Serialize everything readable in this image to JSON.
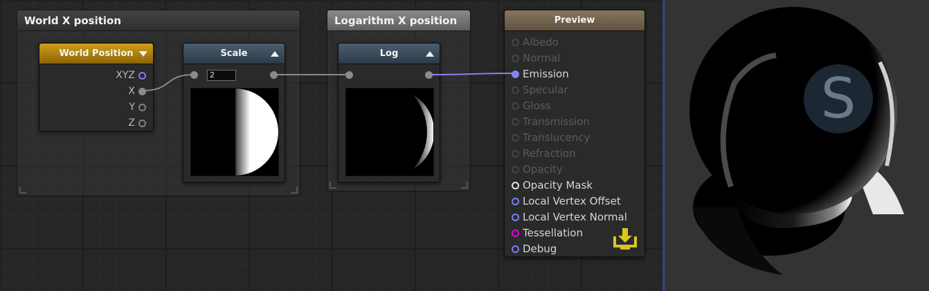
{
  "comments": {
    "world_x": {
      "title": "World X position"
    },
    "log_x": {
      "title": "Logarithm X position"
    }
  },
  "world_position_node": {
    "title": "World Position",
    "outputs": [
      "XYZ",
      "X",
      "Y",
      "Z"
    ]
  },
  "scale_node": {
    "title": "Scale",
    "value": "2"
  },
  "log_node": {
    "title": "Log"
  },
  "preview_node": {
    "title": "Preview",
    "slots": [
      {
        "label": "Albedo",
        "active": false
      },
      {
        "label": "Normal",
        "active": false
      },
      {
        "label": "Emission",
        "active": true
      },
      {
        "label": "Specular",
        "active": false
      },
      {
        "label": "Gloss",
        "active": false
      },
      {
        "label": "Transmission",
        "active": false
      },
      {
        "label": "Translucency",
        "active": false
      },
      {
        "label": "Refraction",
        "active": false
      },
      {
        "label": "Opacity",
        "active": false
      },
      {
        "label": "Opacity Mask",
        "active": true
      },
      {
        "label": "Local Vertex Offset",
        "active": true
      },
      {
        "label": "Local Vertex Normal",
        "active": true
      },
      {
        "label": "Tessellation",
        "active": true
      },
      {
        "label": "Debug",
        "active": true
      }
    ]
  },
  "viewport": {
    "logo_letter": "S"
  },
  "colors": {
    "world_position_header": "#cf9e1a",
    "operator_header": "#4b5d70",
    "preview_header": "#857560",
    "wire": "#8a8a8a",
    "emission_wire": "#8585f2",
    "tessellation_port": "#e000e0",
    "import_icon": "#d6c81f"
  }
}
